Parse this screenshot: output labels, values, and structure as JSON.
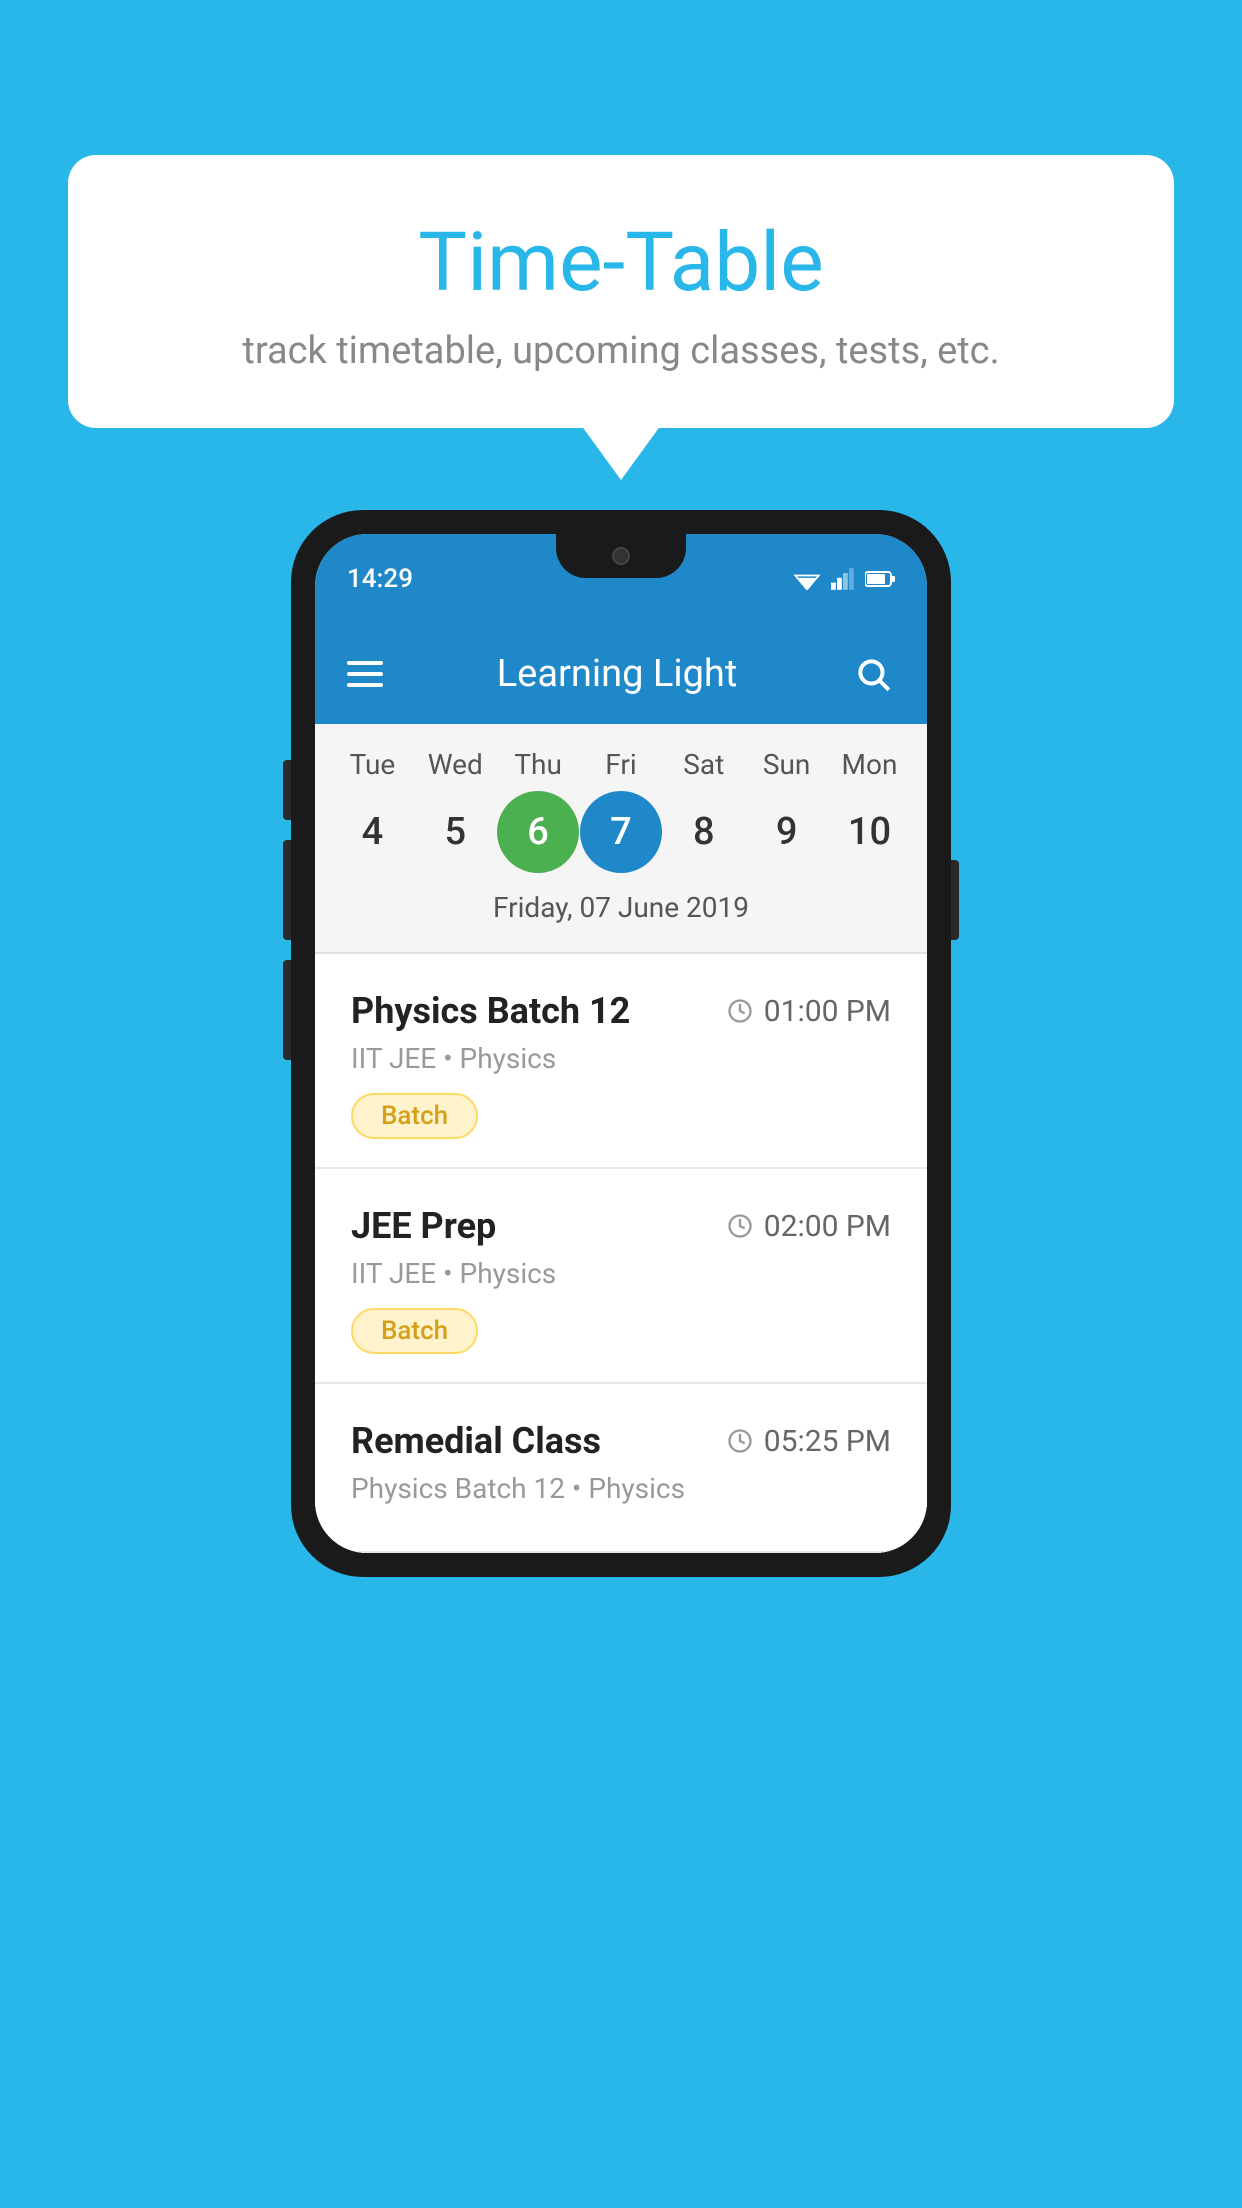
{
  "background_color": "#29b6e8",
  "bubble": {
    "title": "Time-Table",
    "subtitle": "track timetable, upcoming classes, tests, etc."
  },
  "phone": {
    "status_time": "14:29",
    "app_title": "Learning Light",
    "calendar": {
      "days": [
        {
          "label": "Tue",
          "num": "4"
        },
        {
          "label": "Wed",
          "num": "5"
        },
        {
          "label": "Thu",
          "num": "6",
          "state": "today"
        },
        {
          "label": "Fri",
          "num": "7",
          "state": "selected"
        },
        {
          "label": "Sat",
          "num": "8"
        },
        {
          "label": "Sun",
          "num": "9"
        },
        {
          "label": "Mon",
          "num": "10"
        }
      ],
      "date_display": "Friday, 07 June 2019"
    },
    "classes": [
      {
        "name": "Physics Batch 12",
        "time": "01:00 PM",
        "meta": "IIT JEE • Physics",
        "badge": "Batch"
      },
      {
        "name": "JEE Prep",
        "time": "02:00 PM",
        "meta": "IIT JEE • Physics",
        "badge": "Batch"
      },
      {
        "name": "Remedial Class",
        "time": "05:25 PM",
        "meta": "Physics Batch 12 • Physics",
        "badge": null
      }
    ]
  }
}
